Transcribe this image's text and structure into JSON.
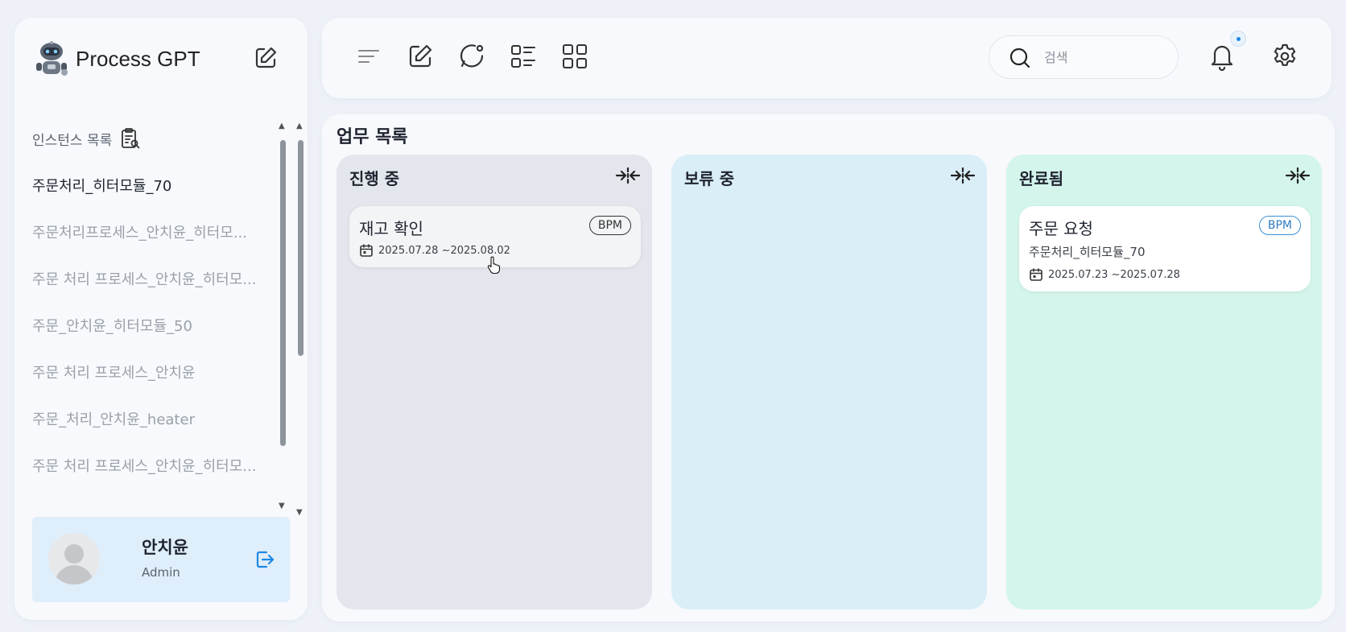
{
  "app": {
    "title": "Process GPT"
  },
  "sidebar": {
    "instances_header": "인스턴스 목록",
    "instances": [
      {
        "label": "주문처리_히터모듈_70",
        "active": true
      },
      {
        "label": "주문처리프로세스_안치윤_히터모...",
        "active": false
      },
      {
        "label": "주문 처리 프로세스_안치윤_히터모...",
        "active": false
      },
      {
        "label": "주문_안치윤_히터모듈_50",
        "active": false
      },
      {
        "label": "주문 처리 프로세스_안치윤",
        "active": false
      },
      {
        "label": "주문_처리_안치윤_heater",
        "active": false
      },
      {
        "label": "주문 처리 프로세스_안치윤_히터모...",
        "active": false
      }
    ],
    "user": {
      "name": "안치윤",
      "role": "Admin"
    }
  },
  "topbar": {
    "search_placeholder": "검색"
  },
  "board": {
    "title": "업무 목록",
    "columns": [
      {
        "title": "진행 중",
        "cards": [
          {
            "title": "재고 확인",
            "badge": "BPM",
            "date": "2025.07.28 ~2025.08.02"
          }
        ]
      },
      {
        "title": "보류 중",
        "cards": []
      },
      {
        "title": "완료됨",
        "cards": [
          {
            "title": "주문 요청",
            "badge": "BPM",
            "subtitle": "주문처리_히터모듈_70",
            "date": "2025.07.23 ~2025.07.28"
          }
        ]
      }
    ]
  },
  "colors": {
    "in_progress_bg": "#e3e6ec",
    "on_hold_bg": "#daeef8",
    "done_bg": "#d4f5ec",
    "accent": "#1e88e5"
  }
}
